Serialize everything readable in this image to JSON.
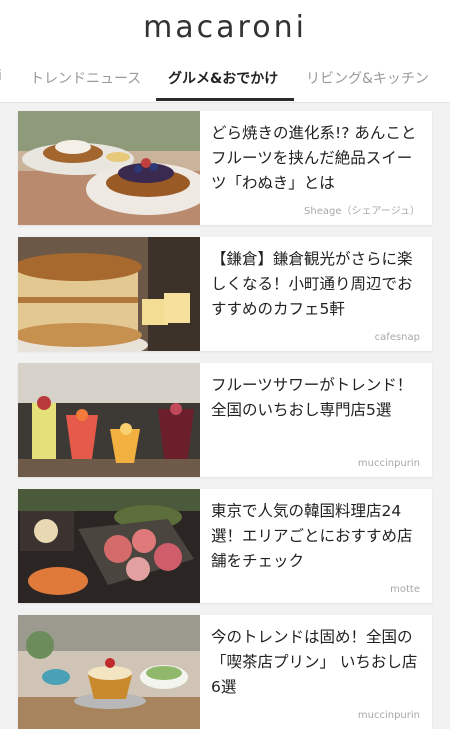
{
  "header": {
    "logo": "macaroni",
    "tabs": [
      {
        "label": "i"
      },
      {
        "label": "トレンドニュース"
      },
      {
        "label": "グルメ&おでかけ"
      },
      {
        "label": "リビング&キッチン"
      }
    ],
    "active_tab_index": 2
  },
  "articles": [
    {
      "title": "どら焼きの進化系!? あんことフルーツを挟んだ絶品スイーツ「わぬき」とは",
      "source": "Sheage（シェアージュ）"
    },
    {
      "title": "【鎌倉】鎌倉観光がさらに楽しくなる！小町通り周辺でおすすめのカフェ5軒",
      "source": "cafesnap"
    },
    {
      "title": "フルーツサワーがトレンド！全国のいちおし専門店5選",
      "source": "muccinpurin"
    },
    {
      "title": "東京で人気の韓国料理店24選！エリアごとにおすすめ店舗をチェック",
      "source": "motte"
    },
    {
      "title": "今のトレンドは固め！全国の「喫茶店プリン」 いちおし店6選",
      "source": "muccinpurin"
    }
  ]
}
